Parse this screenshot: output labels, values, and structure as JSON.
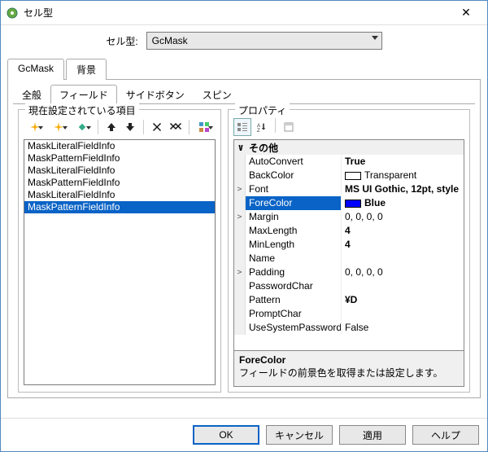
{
  "window": {
    "title": "セル型"
  },
  "header": {
    "label": "セル型:",
    "selected": "GcMask"
  },
  "outer_tabs": [
    "GcMask",
    "背景"
  ],
  "outer_active": 0,
  "inner_tabs": [
    "全般",
    "フィールド",
    "サイドボタン",
    "スピン"
  ],
  "inner_active": 1,
  "left": {
    "legend": "現在設定されている項目",
    "items": [
      "MaskLiteralFieldInfo",
      "MaskPatternFieldInfo",
      "MaskLiteralFieldInfo",
      "MaskPatternFieldInfo",
      "MaskLiteralFieldInfo",
      "MaskPatternFieldInfo"
    ],
    "selected_index": 5
  },
  "right": {
    "legend": "プロパティ",
    "category": "その他",
    "rows": [
      {
        "name": "AutoConvert",
        "value": "True",
        "bold": true
      },
      {
        "name": "BackColor",
        "value": "Transparent",
        "swatch": "trans"
      },
      {
        "name": "Font",
        "value": "MS UI Gothic, 12pt, style",
        "bold": true,
        "expand": ">"
      },
      {
        "name": "ForeColor",
        "value": "Blue",
        "bold": true,
        "swatch": "blue",
        "selected": true
      },
      {
        "name": "Margin",
        "value": "0, 0, 0, 0",
        "expand": ">"
      },
      {
        "name": "MaxLength",
        "value": "4",
        "bold": true
      },
      {
        "name": "MinLength",
        "value": "4",
        "bold": true
      },
      {
        "name": "Name",
        "value": ""
      },
      {
        "name": "Padding",
        "value": "0, 0, 0, 0",
        "expand": ">"
      },
      {
        "name": "PasswordChar",
        "value": ""
      },
      {
        "name": "Pattern",
        "value": "¥D",
        "bold": true
      },
      {
        "name": "PromptChar",
        "value": ""
      },
      {
        "name": "UseSystemPassword",
        "value": "False"
      }
    ],
    "desc_name": "ForeColor",
    "desc_text": "フィールドの前景色を取得または設定します。"
  },
  "buttons": {
    "ok": "OK",
    "cancel": "キャンセル",
    "apply": "適用",
    "help": "ヘルプ"
  }
}
